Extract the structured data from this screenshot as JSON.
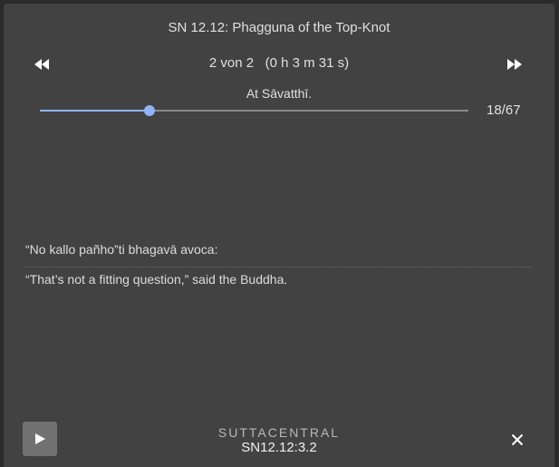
{
  "header": {
    "title": "SN 12.12: Phagguna of the Top-Knot",
    "track_info": "2 von 2   (0 h 3 m 31 s)",
    "segment_title": "At Sāvatthī.",
    "prev_icon": "rewind-icon",
    "next_icon": "fast-forward-icon"
  },
  "progress": {
    "counter": "18/67",
    "current": 18,
    "total": 67,
    "fraction": 0.255,
    "accent_color": "#90b4f8"
  },
  "content": {
    "pali": "“No kallo pañho”ti bhagavā avoca:",
    "translation": "“That’s not a fitting question,” said the Buddha."
  },
  "footer": {
    "brand": "SUTTACENTRAL",
    "reference": "SN12.12:3.2",
    "play_icon": "play-icon",
    "close_icon": "close-icon"
  }
}
